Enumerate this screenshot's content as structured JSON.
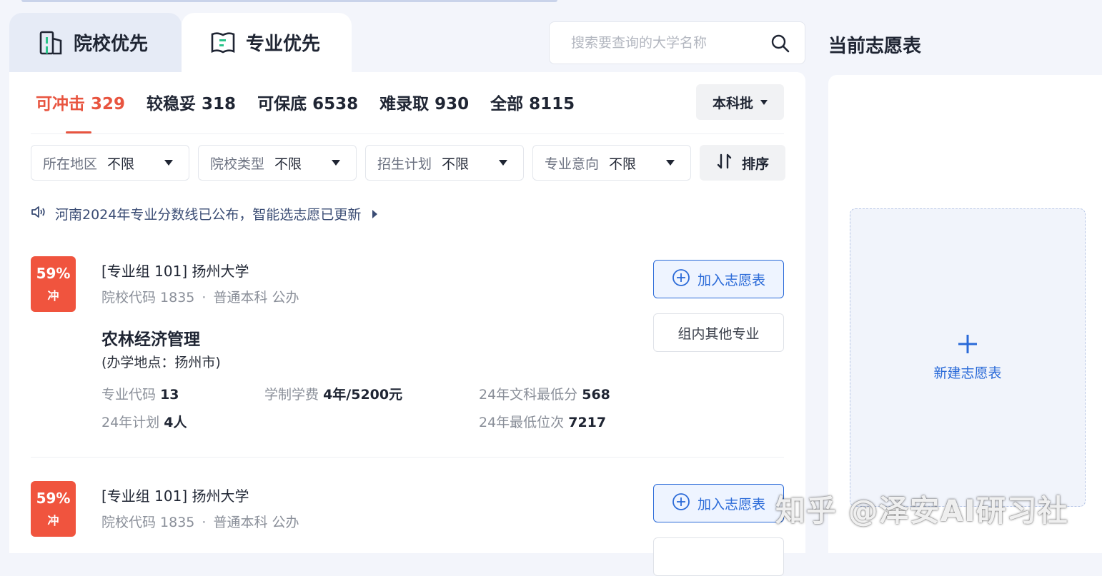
{
  "tabs": [
    {
      "label": "院校优先"
    },
    {
      "label": "专业优先"
    }
  ],
  "search": {
    "placeholder": "搜索要查询的大学名称"
  },
  "categories": [
    {
      "label": "可冲击",
      "count": "329"
    },
    {
      "label": "较稳妥",
      "count": "318"
    },
    {
      "label": "可保底",
      "count": "6538"
    },
    {
      "label": "难录取",
      "count": "930"
    },
    {
      "label": "全部",
      "count": "8115"
    }
  ],
  "batch": {
    "label": "本科批"
  },
  "filters": [
    {
      "label": "所在地区",
      "value": "不限"
    },
    {
      "label": "院校类型",
      "value": "不限"
    },
    {
      "label": "招生计划",
      "value": "不限"
    },
    {
      "label": "专业意向",
      "value": "不限"
    }
  ],
  "sort": {
    "label": "排序"
  },
  "notice": {
    "text": "河南2024年专业分数线已公布，智能选志愿已更新"
  },
  "cards": [
    {
      "probability": "59%",
      "level": "冲",
      "group_title": "[专业组 101] 扬州大学",
      "school_code_label": "院校代码 1835",
      "school_type": "普通本科 公办",
      "major": "农林经济管理",
      "campus": "(办学地点：扬州市)",
      "major_code_label": "专业代码",
      "major_code": "13",
      "duration_label": "学制学费",
      "duration": "4年/5200元",
      "min_score_label": "24年文科最低分",
      "min_score": "568",
      "plan_label": "24年计划",
      "plan": "4人",
      "min_rank_label": "24年最低位次",
      "min_rank": "7217",
      "add_label": "加入志愿表",
      "other_label": "组内其他专业"
    },
    {
      "probability": "59%",
      "level": "冲",
      "group_title": "[专业组 101] 扬州大学",
      "school_code_label": "院校代码 1835",
      "school_type": "普通本科 公办",
      "add_label": "加入志愿表"
    }
  ],
  "right": {
    "title": "当前志愿表",
    "new_label": "新建志愿表"
  },
  "watermark": "知乎 @泽安AI研习社",
  "colors": {
    "accent": "#2a6ad8",
    "danger": "#f0543e",
    "active_tab_text": "#e8543f"
  }
}
